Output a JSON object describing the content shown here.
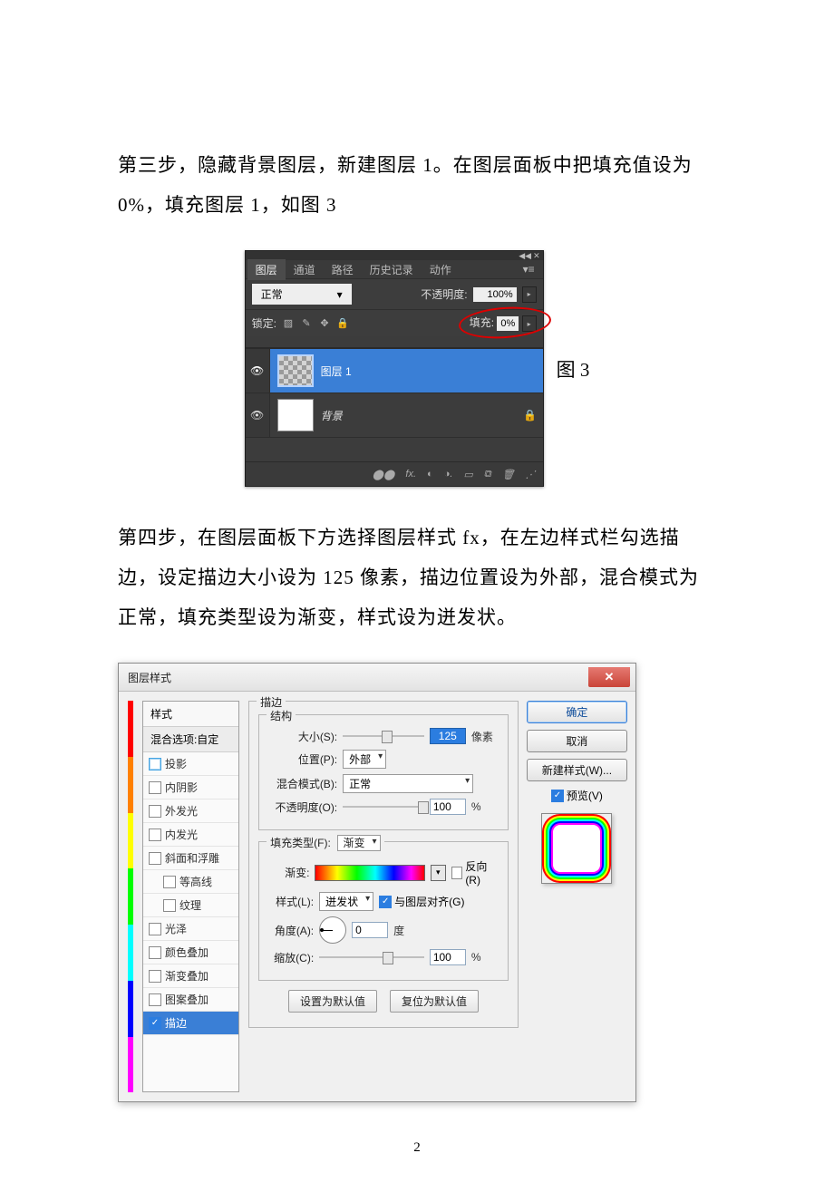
{
  "text": {
    "step3": "第三步，隐藏背景图层，新建图层 1。在图层面板中把填充值设为 0%，填充图层 1，如图 3",
    "fig3_label": "图 3",
    "step4": "第四步，在图层面板下方选择图层样式 fx，在左边样式栏勾选描边，设定描边大小设为 125 像素，描边位置设为外部，混合模式为正常，填充类型设为渐变，样式设为迸发状。",
    "page_number": "2"
  },
  "layers_panel": {
    "tabs": [
      "图层",
      "通道",
      "路径",
      "历史记录",
      "动作"
    ],
    "active_tab": "图层",
    "blend_mode": "正常",
    "opacity_label": "不透明度:",
    "opacity_value": "100%",
    "lock_label": "锁定:",
    "fill_label": "填充:",
    "fill_value": "0%",
    "layers": [
      {
        "name": "图层 1",
        "selected": true,
        "bg": false
      },
      {
        "name": "背景",
        "selected": false,
        "bg": true
      }
    ],
    "footer_icons": [
      "⬤⬤",
      "fx.",
      "◐",
      "◑.",
      "▭",
      "⧉",
      "🗑",
      "⋰"
    ]
  },
  "layer_style": {
    "title": "图层样式",
    "close": "✕",
    "left": {
      "styles_head": "样式",
      "blend_head": "混合选项:自定",
      "items": [
        {
          "label": "投影",
          "checked": "blue-empty",
          "indent": false
        },
        {
          "label": "内阴影",
          "checked": "no",
          "indent": false
        },
        {
          "label": "外发光",
          "checked": "no",
          "indent": false
        },
        {
          "label": "内发光",
          "checked": "no",
          "indent": false
        },
        {
          "label": "斜面和浮雕",
          "checked": "no",
          "indent": false
        },
        {
          "label": "等高线",
          "checked": "no",
          "indent": true
        },
        {
          "label": "纹理",
          "checked": "no",
          "indent": true
        },
        {
          "label": "光泽",
          "checked": "no",
          "indent": false
        },
        {
          "label": "颜色叠加",
          "checked": "no",
          "indent": false
        },
        {
          "label": "渐变叠加",
          "checked": "no",
          "indent": false
        },
        {
          "label": "图案叠加",
          "checked": "no",
          "indent": false
        },
        {
          "label": "描边",
          "checked": "yes",
          "indent": false,
          "selected": true
        }
      ]
    },
    "center": {
      "group1_title": "描边",
      "group1_sub": "结构",
      "size_label": "大小(S):",
      "size_value": "125",
      "size_unit": "像素",
      "position_label": "位置(P):",
      "position_value": "外部",
      "blend_label": "混合模式(B):",
      "blend_value": "正常",
      "opacity_label": "不透明度(O):",
      "opacity_value": "100",
      "opacity_unit": "%",
      "fill_type_label": "填充类型(F):",
      "fill_type_value": "渐变",
      "grad_label": "渐变:",
      "reverse_label": "反向(R)",
      "style_label": "样式(L):",
      "style_value": "迸发状",
      "align_label": "与图层对齐(G)",
      "angle_label": "角度(A):",
      "angle_value": "0",
      "angle_unit": "度",
      "scale_label": "缩放(C):",
      "scale_value": "100",
      "scale_unit": "%",
      "btn_default": "设置为默认值",
      "btn_reset": "复位为默认值"
    },
    "right": {
      "ok": "确定",
      "cancel": "取消",
      "new_style": "新建样式(W)...",
      "preview": "预览(V)"
    }
  }
}
